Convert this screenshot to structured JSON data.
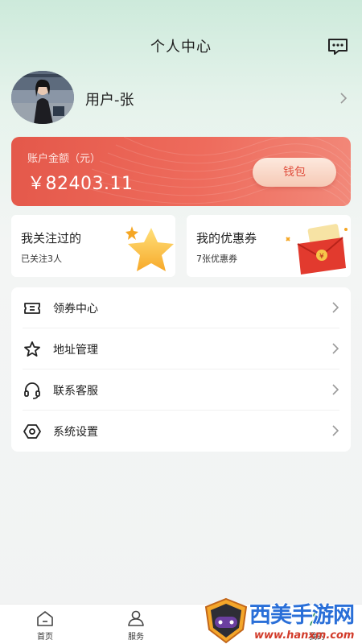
{
  "header": {
    "title": "个人中心",
    "message_icon": "chat-bubble-icon"
  },
  "profile": {
    "username": "用户-张",
    "avatar": "user-avatar-photo"
  },
  "balance": {
    "label": "账户金额（元）",
    "amount": "￥82403.11",
    "wallet_button": "钱包"
  },
  "cards": [
    {
      "title": "我关注过的",
      "subtitle": "已关注3人",
      "icon": "star-icon"
    },
    {
      "title": "我的优惠券",
      "subtitle": "7张优惠券",
      "icon": "coupon-gift-icon"
    }
  ],
  "menu": [
    {
      "label": "领券中心",
      "icon": "ticket-icon"
    },
    {
      "label": "地址管理",
      "icon": "star-outline-icon"
    },
    {
      "label": "联系客服",
      "icon": "headset-icon"
    },
    {
      "label": "系统设置",
      "icon": "settings-hexagon-icon"
    }
  ],
  "tabs": [
    {
      "label": "首页",
      "icon": "home-icon"
    },
    {
      "label": "服务",
      "icon": "service-icon"
    },
    {
      "label": "我的",
      "icon": "profile-icon"
    }
  ],
  "watermark": {
    "text": "西美手游网",
    "url": "www.hanxm.com"
  },
  "colors": {
    "accent": "#e4584a",
    "header_bg": "#cdeadb",
    "wallet_text": "#e0503f"
  }
}
